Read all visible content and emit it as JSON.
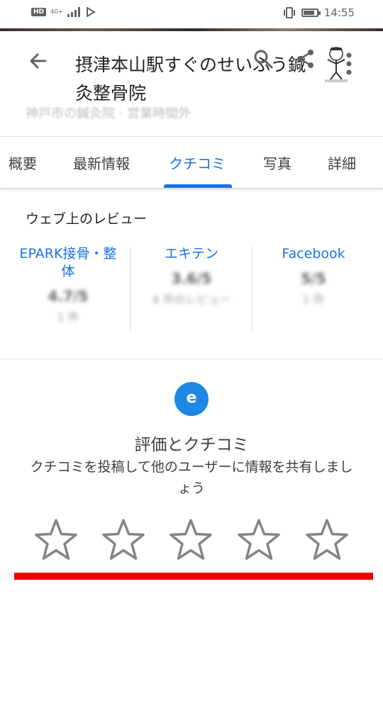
{
  "status_bar": {
    "hd_label": "HD",
    "network_label": "4G+",
    "time": "14:55",
    "battery_level": 0.85
  },
  "header": {
    "title": "摂津本山駅すぐのせいふう鍼灸整骨院",
    "subtitle": "神戸市の鍼灸院 · 営業時間外",
    "icons": [
      "back-arrow-icon",
      "search-icon",
      "share-icon",
      "more-vert-icon"
    ]
  },
  "tabs": [
    {
      "label": "概要",
      "active": false
    },
    {
      "label": "最新情報",
      "active": false
    },
    {
      "label": "クチコミ",
      "active": true
    },
    {
      "label": "写真",
      "active": false
    },
    {
      "label": "詳細",
      "active": false
    }
  ],
  "web_reviews": {
    "title": "ウェブ上のレビュー",
    "sources": [
      {
        "name": "EPARK接骨・整体",
        "score": "4.7/5",
        "count": "1 件"
      },
      {
        "name": "エキテン",
        "score": "3.6/5",
        "count": "4 件のレビュー"
      },
      {
        "name": "Facebook",
        "score": "5/5",
        "count": "1 件"
      }
    ]
  },
  "rate": {
    "avatar_letter": "e",
    "title": "評価とクチコミ",
    "description": "クチコミを投稿して他のユーザーに情報を共有しましょう",
    "stars_total": 5,
    "stars_selected": 0
  },
  "colors": {
    "accent": "#1a73e8",
    "avatar": "#1e88e5",
    "highlight_bar": "#ee0000",
    "star_outline": "#80868b"
  }
}
